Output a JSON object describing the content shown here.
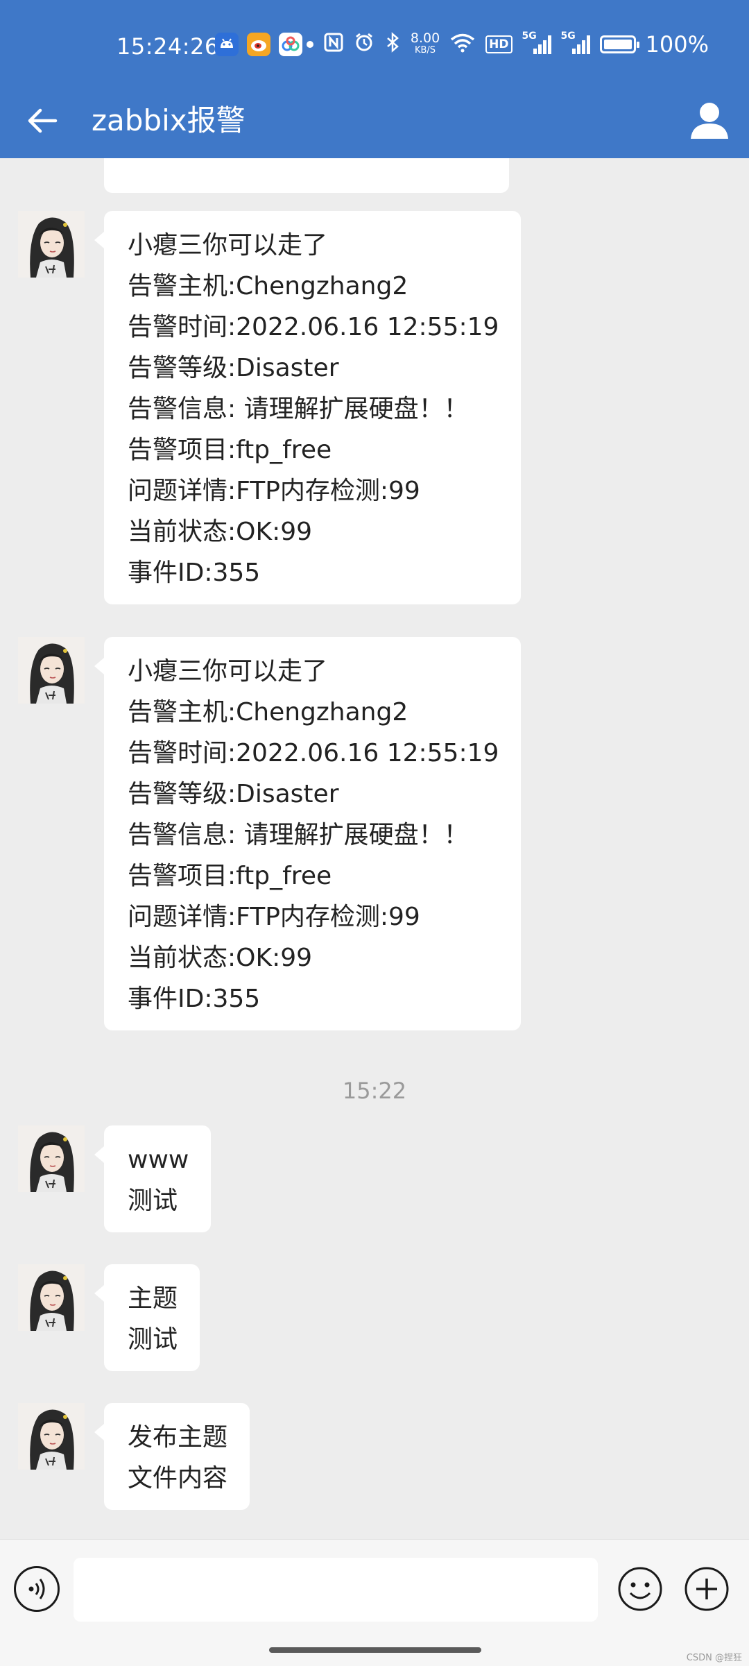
{
  "status_bar": {
    "time": "15:24:26",
    "network_speed_value": "8.00",
    "network_speed_unit": "KB/S",
    "hd_label": "HD",
    "signal_1_label": "5G",
    "signal_2_label": "5G",
    "battery_percent": "100%",
    "battery_level": 1.0
  },
  "header": {
    "title": "zabbix报警"
  },
  "messages": [
    {
      "lines": [
        "小瘪三你可以走了",
        "告警主机:Chengzhang2",
        "告警时间:2022.06.16 12:55:19",
        "告警等级:Disaster",
        "告警信息: 请理解扩展硬盘！！",
        "告警项目:ftp_free",
        "问题详情:FTP内存检测:99",
        "当前状态:OK:99",
        "事件ID:355"
      ]
    },
    {
      "lines": [
        "小瘪三你可以走了",
        "告警主机:Chengzhang2",
        "告警时间:2022.06.16 12:55:19",
        "告警等级:Disaster",
        "告警信息: 请理解扩展硬盘！！",
        "告警项目:ftp_free",
        "问题详情:FTP内存检测:99",
        "当前状态:OK:99",
        "事件ID:355"
      ]
    },
    {
      "lines": [
        "www",
        "测试"
      ]
    },
    {
      "lines": [
        "主题",
        "测试"
      ]
    },
    {
      "lines": [
        "发布主题",
        "文件内容"
      ]
    }
  ],
  "timestamp_divider": "15:22",
  "input_bar": {
    "value": "",
    "placeholder": ""
  },
  "watermark": "CSDN @捏狂",
  "colors": {
    "header_bg": "#3f78c8",
    "chat_bg": "#ededed",
    "bubble_bg": "#ffffff"
  }
}
